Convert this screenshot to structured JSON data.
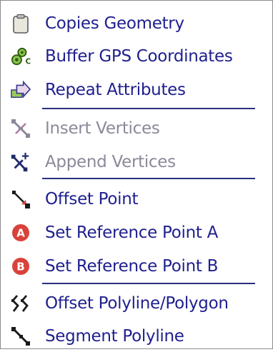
{
  "menu": {
    "items": [
      {
        "label": "Copies Geometry",
        "icon": "clipboard-icon",
        "enabled": true
      },
      {
        "label": "Buffer GPS Coordinates",
        "icon": "gps-buffer-icon",
        "enabled": true
      },
      {
        "label": "Repeat Attributes",
        "icon": "repeat-arrow-icon",
        "enabled": true
      },
      {
        "label": "Insert Vertices",
        "icon": "insert-vertices-icon",
        "enabled": false
      },
      {
        "label": "Append Vertices",
        "icon": "append-vertices-icon",
        "enabled": false
      },
      {
        "label": "Offset Point",
        "icon": "offset-point-icon",
        "enabled": true
      },
      {
        "label": "Set Reference Point A",
        "icon": "reference-a-icon",
        "badge": "A",
        "enabled": true
      },
      {
        "label": "Set Reference Point B",
        "icon": "reference-b-icon",
        "badge": "B",
        "enabled": true
      },
      {
        "label": "Offset Polyline/Polygon",
        "icon": "offset-polyline-icon",
        "enabled": true
      },
      {
        "label": "Segment Polyline",
        "icon": "segment-polyline-icon",
        "enabled": true
      }
    ]
  },
  "colors": {
    "text": "#1f1f8f",
    "disabled_text": "#8a8a9a",
    "separator": "#2b2f7a",
    "badge": "#d9423a"
  }
}
